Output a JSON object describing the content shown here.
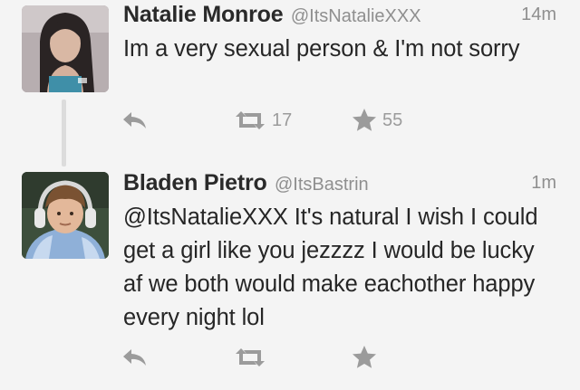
{
  "tweets": [
    {
      "name": "Natalie Monroe",
      "handle": "@ItsNatalieXXX",
      "time": "14m",
      "text": "Im a very sexual person & I'm not sorry",
      "retweets": "17",
      "favorites": "55"
    },
    {
      "name": "Bladen Pietro",
      "handle": "@ItsBastrin",
      "time": "1m",
      "text": "@ItsNatalieXXX It's natural I wish I could get a girl like you jezzzz I would be lucky af we both would make eachother happy every night lol",
      "retweets": "",
      "favorites": ""
    }
  ],
  "icons": {
    "reply": "reply-icon",
    "retweet": "retweet-icon",
    "favorite": "star-icon"
  },
  "colors": {
    "background": "#f4f4f4",
    "text": "#262626",
    "muted": "#8f8f8f",
    "icon": "#9b9b9b"
  }
}
